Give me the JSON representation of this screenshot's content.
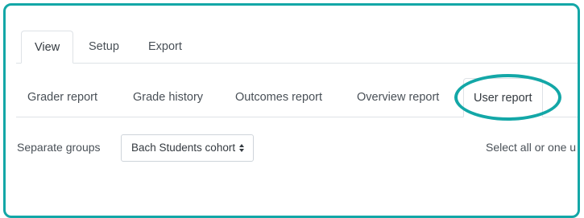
{
  "top_tabs": [
    {
      "label": "View",
      "active": true
    },
    {
      "label": "Setup",
      "active": false
    },
    {
      "label": "Export",
      "active": false
    }
  ],
  "report_tabs": [
    {
      "label": "Grader report",
      "active": false
    },
    {
      "label": "Grade history",
      "active": false
    },
    {
      "label": "Outcomes report",
      "active": false
    },
    {
      "label": "Overview report",
      "active": false
    },
    {
      "label": "User report",
      "active": true
    }
  ],
  "groups": {
    "label": "Separate groups",
    "selected": "Bach Students cohort"
  },
  "selector_hint": "Select all or one u",
  "colors": {
    "highlight": "#13a7a7",
    "tab_border": "#dee2e6",
    "text": "#495057"
  }
}
